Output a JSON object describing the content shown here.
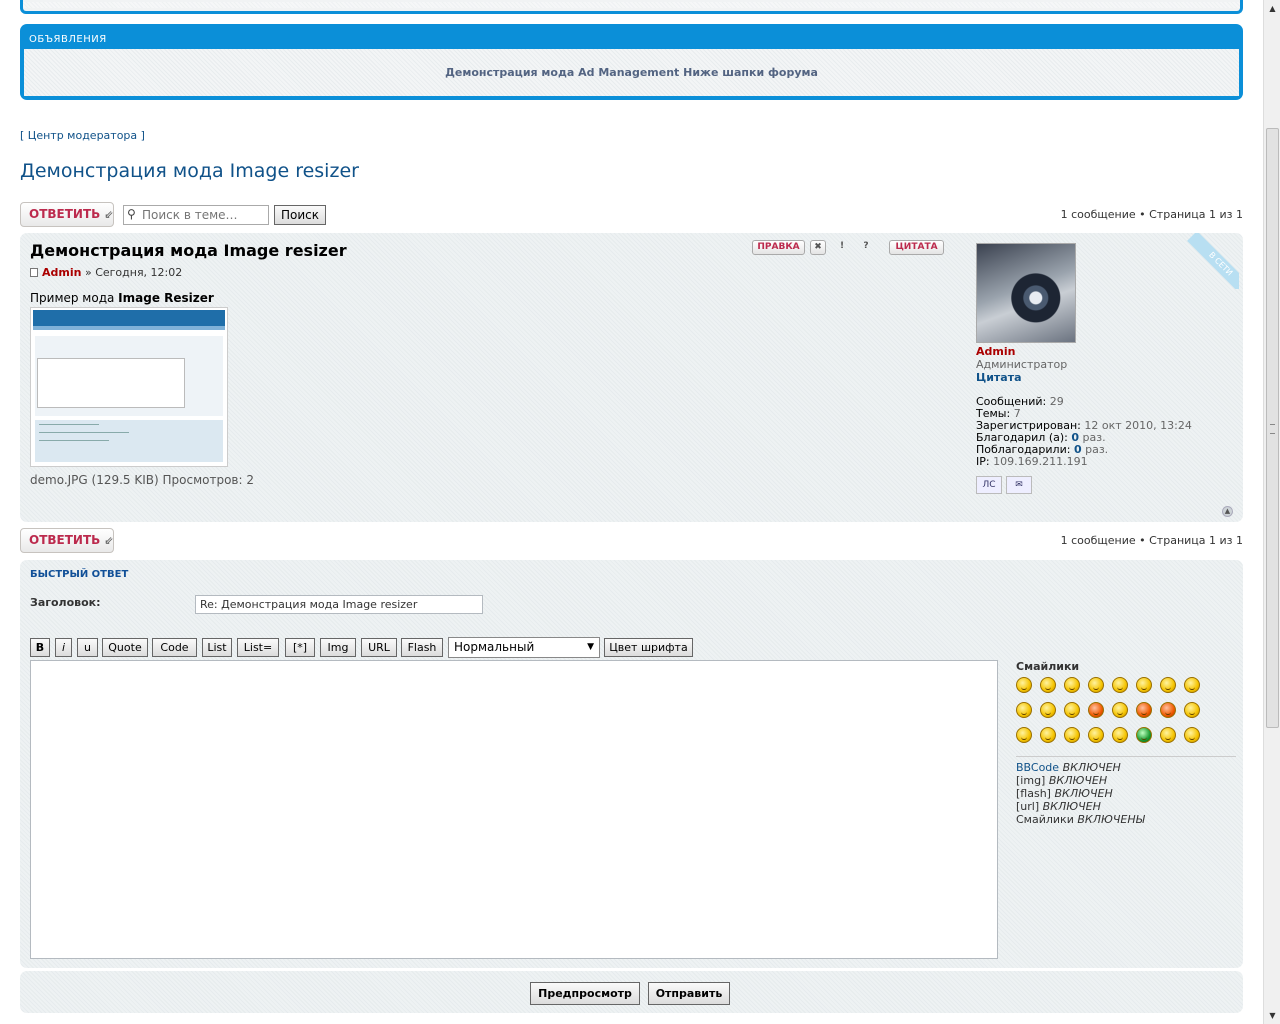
{
  "announcement": {
    "heading": "ОБЪЯВЛЕНИЯ",
    "text": "Демонстрация мода Ad Management Ниже шапки форума"
  },
  "moderator_link": "[ Центр модератора ]",
  "topic_title": "Демонстрация мода Image resizer",
  "actions": {
    "reply_label": "ОТВЕТИТЬ",
    "search_placeholder": "Поиск в теме…",
    "search_button": "Поиск",
    "pagination": "1 сообщение • Страница 1 из 1"
  },
  "post": {
    "title": "Демонстрация мода Image resizer",
    "author": "Admin",
    "date": "Сегодня, 12:02",
    "text_prefix": "Пример мода ",
    "text_bold": "Image Resizer",
    "attachment": "demo.JPG (129.5 KIB) Просмотров: 2",
    "buttons": {
      "edit": "ПРАВКА",
      "quote": "ЦИТАТА"
    },
    "online": "В СЕТИ"
  },
  "profile": {
    "name": "Admin",
    "rank": "Администратор",
    "quote_link": "Цитата",
    "stats": {
      "posts_label": "Сообщений:",
      "posts": "29",
      "topics_label": "Темы:",
      "topics": "7",
      "registered_label": "Зарегистрирован:",
      "registered": "12 окт 2010, 13:24",
      "thanked_label": "Благодарил (а):",
      "thanked": "0",
      "thanked_unit": "раз.",
      "thanks_label": "Поблагодарили:",
      "thanks": "0",
      "thanks_unit": "раз.",
      "ip_label": "IP:",
      "ip": "109.169.211.191"
    },
    "pm_label": "ЛС"
  },
  "quick_reply": {
    "heading": "БЫСТРЫЙ ОТВЕТ",
    "subject_label": "Заголовок:",
    "subject_value": "Re: Демонстрация мода Image resizer",
    "bbcode_buttons": [
      "B",
      "i",
      "u",
      "Quote",
      "Code",
      "List",
      "List=",
      "[*]",
      "Img",
      "URL",
      "Flash"
    ],
    "font_size": "Нормальный",
    "font_color_button": "Цвет шрифта",
    "smilies_title": "Смайлики",
    "bbcode_status": {
      "bbcode": "BBCode",
      "bbcode_state": "ВКЛЮЧЕН",
      "img": "[img]",
      "img_state": "ВКЛЮЧЕН",
      "flash": "[flash]",
      "flash_state": "ВКЛЮЧЕН",
      "url": "[url]",
      "url_state": "ВКЛЮЧЕН",
      "smilies": "Смайлики",
      "smilies_state": "ВКЛЮЧЕНЫ"
    }
  },
  "submit": {
    "preview": "Предпросмотр",
    "send": "Отправить"
  },
  "colors": {
    "accent": "#0b8fd8",
    "link": "#105289",
    "reply": "#bc2a4d",
    "author": "#aa0000"
  }
}
